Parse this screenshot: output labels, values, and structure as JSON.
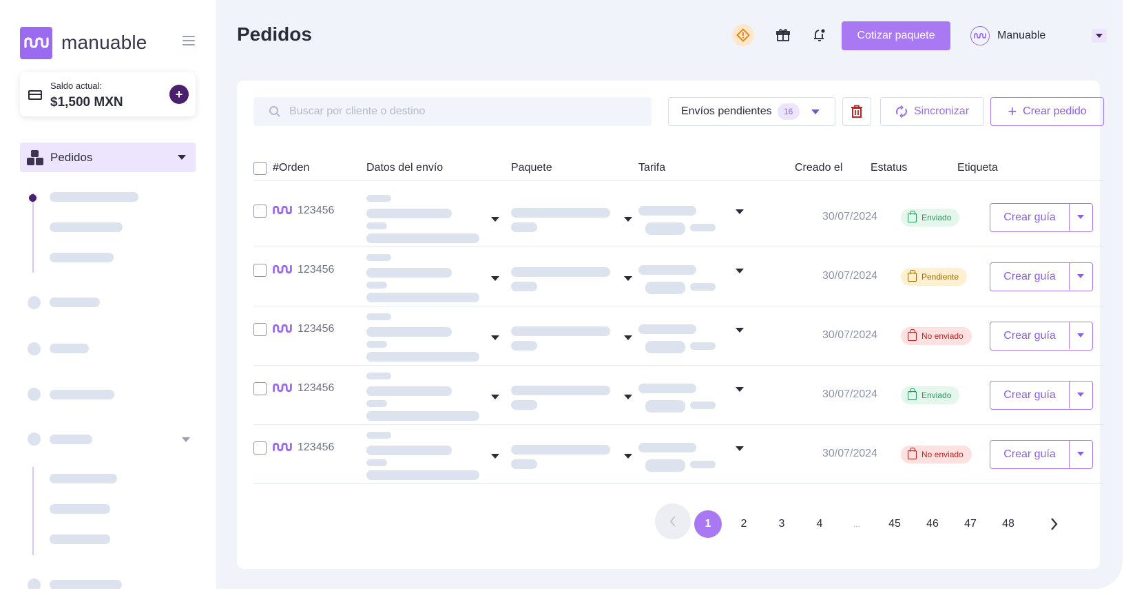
{
  "brand": {
    "name": "manuable",
    "color": "#9a6bf0"
  },
  "sidebar": {
    "balance_label": "Saldo actual:",
    "balance_value": "$1,500 MXN",
    "add_symbol": "+",
    "active_item": "Pedidos"
  },
  "header": {
    "title": "Pedidos",
    "quote_button": "Cotizar paquete",
    "user_name": "Manuable"
  },
  "toolbar": {
    "search_placeholder": "Buscar por cliente o destino",
    "filter_label": "Envíos pendientes",
    "filter_count": "16",
    "sync_label": "Sincronizar",
    "create_label": "Crear pedido",
    "create_symbol": "+"
  },
  "table": {
    "columns": [
      "#Orden",
      "Datos del envío",
      "Paquete",
      "Tarifa",
      "Creado el",
      "Estatus",
      "Etiqueta"
    ],
    "rows": [
      {
        "order": "123456",
        "date": "30/07/2024",
        "status": "Enviado",
        "status_kind": "sent",
        "action": "Crear guía"
      },
      {
        "order": "123456",
        "date": "30/07/2024",
        "status": "Pendiente",
        "status_kind": "pending",
        "action": "Crear guía"
      },
      {
        "order": "123456",
        "date": "30/07/2024",
        "status": "No enviado",
        "status_kind": "notsent",
        "action": "Crear guía"
      },
      {
        "order": "123456",
        "date": "30/07/2024",
        "status": "Enviado",
        "status_kind": "sent",
        "action": "Crear guía"
      },
      {
        "order": "123456",
        "date": "30/07/2024",
        "status": "No enviado",
        "status_kind": "notsent",
        "action": "Crear guía"
      }
    ]
  },
  "pagination": {
    "pages": [
      "1",
      "2",
      "3",
      "4",
      "...",
      "45",
      "46",
      "47",
      "48"
    ],
    "current": "1"
  },
  "colors": {
    "accent": "#a879f2",
    "sent": "#23995a",
    "pending": "#a66a00",
    "not_sent": "#c81e1e"
  }
}
